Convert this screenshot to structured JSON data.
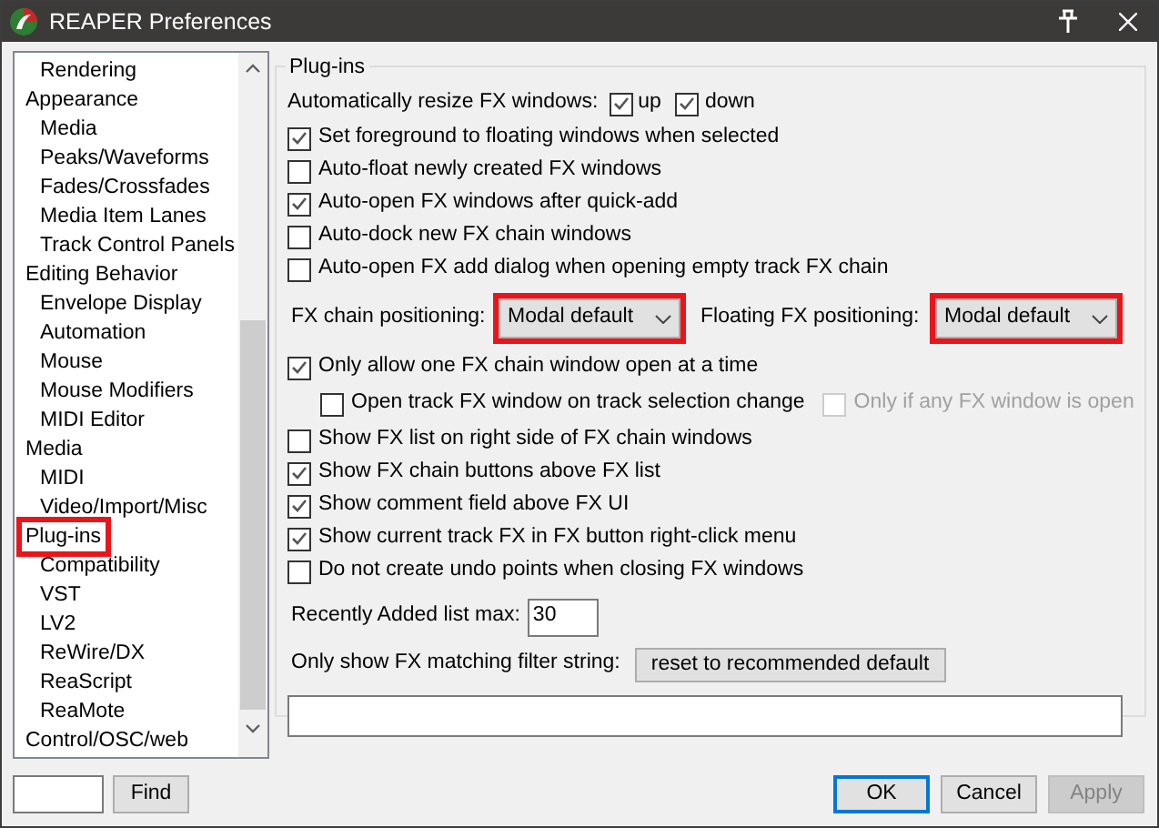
{
  "window": {
    "title": "REAPER Preferences"
  },
  "tree": [
    {
      "children": [
        {
          "label": "Rendering"
        }
      ]
    },
    {
      "label": "Appearance",
      "children": [
        {
          "label": "Media"
        },
        {
          "label": "Peaks/Waveforms"
        },
        {
          "label": "Fades/Crossfades"
        },
        {
          "label": "Media Item Lanes"
        },
        {
          "label": "Track Control Panels"
        }
      ]
    },
    {
      "label": "Editing Behavior",
      "children": [
        {
          "label": "Envelope Display"
        },
        {
          "label": "Automation"
        },
        {
          "label": "Mouse"
        },
        {
          "label": "Mouse Modifiers"
        },
        {
          "label": "MIDI Editor"
        }
      ]
    },
    {
      "label": "Media",
      "children": [
        {
          "label": "MIDI"
        },
        {
          "label": "Video/Import/Misc"
        }
      ]
    },
    {
      "label": "Plug-ins",
      "highlighted": true,
      "children": [
        {
          "label": "Compatibility"
        },
        {
          "label": "VST"
        },
        {
          "label": "LV2"
        },
        {
          "label": "ReWire/DX"
        },
        {
          "label": "ReaScript"
        },
        {
          "label": "ReaMote"
        }
      ]
    },
    {
      "label": "Control/OSC/web"
    }
  ],
  "panel": {
    "title": "Plug-ins",
    "rows": [
      {
        "kind": "check_group",
        "label": "Automatically resize FX windows:",
        "checks": [
          {
            "label": "up",
            "checked": true
          },
          {
            "label": "down",
            "checked": true
          }
        ]
      },
      {
        "kind": "checkbox",
        "label": "Set foreground to floating windows when selected",
        "checked": true
      },
      {
        "kind": "checkbox",
        "label": "Auto-float newly created FX windows",
        "checked": false
      },
      {
        "kind": "checkbox",
        "label": "Auto-open FX windows after quick-add",
        "checked": true
      },
      {
        "kind": "checkbox",
        "label": "Auto-dock new FX chain windows",
        "checked": false
      },
      {
        "kind": "checkbox",
        "label": "Auto-open FX add dialog when opening empty track FX chain",
        "checked": false
      },
      {
        "kind": "dropdowns",
        "fields": [
          {
            "label": "FX chain positioning:",
            "value": "Modal default",
            "highlighted": true
          },
          {
            "label": "Floating FX positioning:",
            "value": "Modal default",
            "highlighted": true
          }
        ]
      },
      {
        "kind": "checkbox",
        "label": "Only allow one FX chain window open at a time",
        "checked": true
      },
      {
        "kind": "sub_checks",
        "checks": [
          {
            "label": "Open track FX window on track selection change",
            "checked": false,
            "disabled": false
          },
          {
            "label": "Only if any FX window is open",
            "checked": false,
            "disabled": true
          }
        ]
      },
      {
        "kind": "checkbox",
        "label": "Show FX list on right side of FX chain windows",
        "checked": false
      },
      {
        "kind": "checkbox",
        "label": "Show FX chain buttons above FX list",
        "checked": true
      },
      {
        "kind": "checkbox",
        "label": "Show comment field above FX UI",
        "checked": true
      },
      {
        "kind": "checkbox",
        "label": "Show current track FX in FX button right-click menu",
        "checked": true
      },
      {
        "kind": "checkbox",
        "label": "Do not create undo points when closing FX windows",
        "checked": false
      },
      {
        "kind": "number",
        "label": "Recently Added list max:",
        "value": "30"
      },
      {
        "kind": "filter",
        "label": "Only show FX matching filter string:",
        "button": "reset to recommended default"
      },
      {
        "kind": "text_field"
      }
    ]
  },
  "find_button": "Find",
  "buttons": [
    {
      "label": "OK",
      "default": true,
      "disabled": false
    },
    {
      "label": "Cancel",
      "default": false,
      "disabled": false
    },
    {
      "label": "Apply",
      "default": false,
      "disabled": true
    }
  ]
}
